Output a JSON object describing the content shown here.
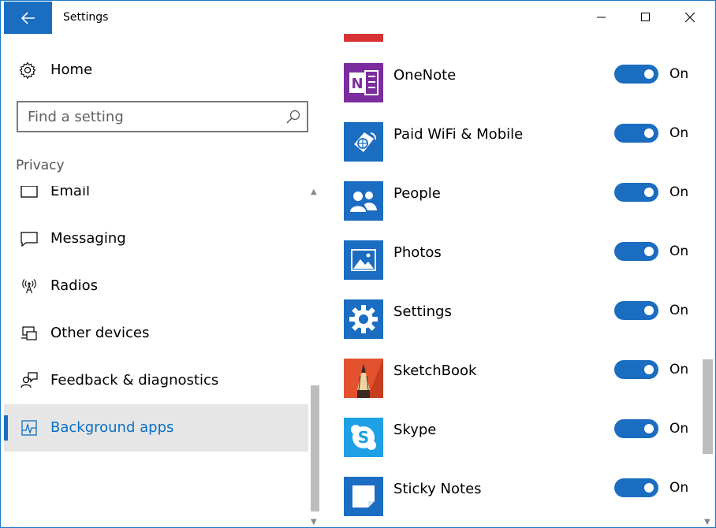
{
  "window": {
    "title": "Settings",
    "accent_color": "#1a6dc0",
    "controls": {
      "minimize": "minimize",
      "maximize": "maximize",
      "close": "close"
    }
  },
  "sidebar": {
    "home_label": "Home",
    "search_placeholder": "Find a setting",
    "section_label": "Privacy",
    "items": [
      {
        "label": "Email",
        "icon": "mail-icon",
        "active": false
      },
      {
        "label": "Messaging",
        "icon": "message-icon",
        "active": false
      },
      {
        "label": "Radios",
        "icon": "radio-antenna-icon",
        "active": false
      },
      {
        "label": "Other devices",
        "icon": "devices-icon",
        "active": false
      },
      {
        "label": "Feedback & diagnostics",
        "icon": "feedback-icon",
        "active": false
      },
      {
        "label": "Background apps",
        "icon": "background-apps-icon",
        "active": true
      }
    ]
  },
  "apps": [
    {
      "name": "OneNote",
      "icon": "onenote-icon",
      "color": "#7b2d9e",
      "state": "On"
    },
    {
      "name": "Paid WiFi & Mobile",
      "icon": "paid-wifi-icon",
      "color": "#1a6dc0",
      "state": "On"
    },
    {
      "name": "People",
      "icon": "people-icon",
      "color": "#1a6dc0",
      "state": "On"
    },
    {
      "name": "Photos",
      "icon": "photos-icon",
      "color": "#1a6dc0",
      "state": "On"
    },
    {
      "name": "Settings",
      "icon": "settings-gear-icon",
      "color": "#1a6dc0",
      "state": "On"
    },
    {
      "name": "SketchBook",
      "icon": "sketchbook-icon",
      "color": "#e4512f",
      "state": "On"
    },
    {
      "name": "Skype",
      "icon": "skype-icon",
      "color": "#1ea0e4",
      "state": "On"
    },
    {
      "name": "Sticky Notes",
      "icon": "sticky-notes-icon",
      "color": "#1a6dc0",
      "state": "On"
    }
  ]
}
